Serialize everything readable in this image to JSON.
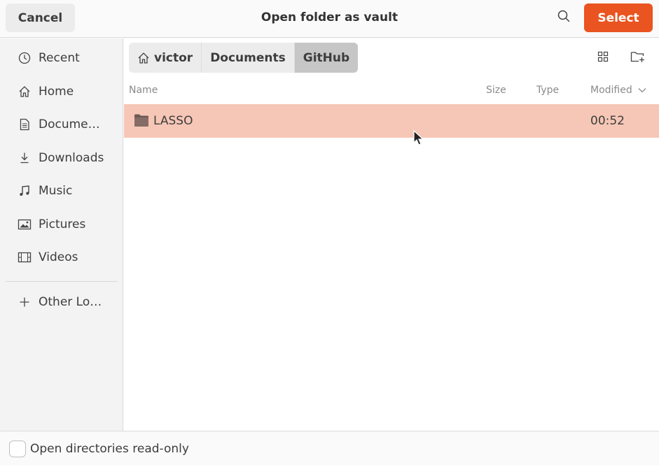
{
  "header": {
    "cancel_label": "Cancel",
    "title": "Open folder as vault",
    "search_icon": "search-icon",
    "select_label": "Select"
  },
  "sidebar": {
    "items": [
      {
        "label": "Recent",
        "icon": "clock-icon"
      },
      {
        "label": "Home",
        "icon": "home-icon"
      },
      {
        "label": "Docume…",
        "icon": "document-icon"
      },
      {
        "label": "Downloads",
        "icon": "download-icon"
      },
      {
        "label": "Music",
        "icon": "music-icon"
      },
      {
        "label": "Pictures",
        "icon": "picture-icon"
      },
      {
        "label": "Videos",
        "icon": "film-icon"
      }
    ],
    "other_locations": {
      "label": "Other Lo…",
      "icon": "plus-icon"
    }
  },
  "pathbar": {
    "crumbs": [
      "victor",
      "Documents",
      "GitHub"
    ]
  },
  "columns": {
    "name": "Name",
    "size": "Size",
    "type": "Type",
    "modified": "Modified"
  },
  "files": [
    {
      "name": "LASSO",
      "size": "",
      "type": "",
      "modified": "00:52",
      "selected": true
    }
  ],
  "footer": {
    "readonly_label": "Open directories read-only",
    "readonly_checked": false
  },
  "colors": {
    "accent": "#e95420",
    "selection": "#f6c7b6"
  }
}
